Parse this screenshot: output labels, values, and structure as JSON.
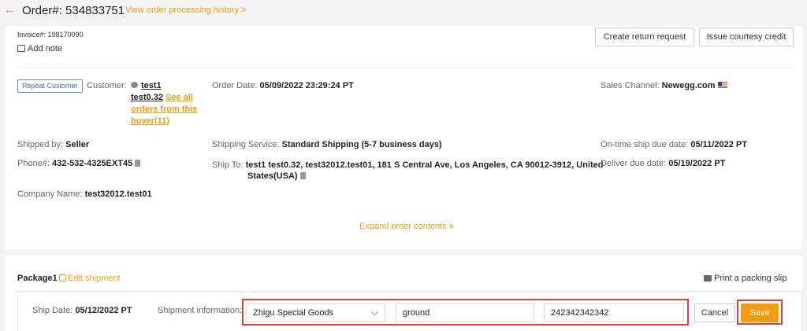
{
  "header": {
    "back_icon": "arrow-left-icon",
    "order_title": "Order#: 534833751",
    "history_link": "View order processing history >"
  },
  "invoice": "Invoice#: 198170090",
  "add_note": "Add note",
  "actions": {
    "create_return": "Create return request",
    "issue_credit": "Issue courtesy credit"
  },
  "customer": {
    "badge": "Repeat Customer",
    "label": "Customer:",
    "name_line1": "test1",
    "name_line2": "test0.32",
    "see_all_1": "See all",
    "see_all_2": "orders from this",
    "see_all_3": "buyer(11)"
  },
  "order_date": {
    "label": "Order Date:",
    "value": "05/09/2022 23:29:24 PT"
  },
  "sales_channel": {
    "label": "Sales Channel:",
    "value": "Newegg.com"
  },
  "shipped_by": {
    "label": "Shipped by:",
    "value": "Seller"
  },
  "shipping_service": {
    "label": "Shipping Service:",
    "value": "Standard Shipping (5-7 business days)"
  },
  "ontime_due": {
    "label": "On-time ship due date:",
    "value": "05/11/2022 PT"
  },
  "phone": {
    "label": "Phone#:",
    "value": "432-532-4325EXT45"
  },
  "ship_to": {
    "label": "Ship To:",
    "line1": "test1 test0.32, test32012.test01, 181 S Central Ave, Los Angeles, CA 90012-3912, United",
    "line2": "States(USA)"
  },
  "deliver_due": {
    "label": "Deliver due date:",
    "value": "05/19/2022 PT"
  },
  "company": {
    "label": "Company Name:",
    "value": "test32012.test01"
  },
  "expand": "Expand order contents",
  "package": {
    "title": "Package1",
    "edit": "Edit shipment",
    "print": "Print a packing slip",
    "ship_date_label": "Ship Date:",
    "ship_date_value": "05/12/2022 PT",
    "shipment_info_label": "Shipment information:",
    "carrier": "Zhigu Special Goods",
    "service": "ground",
    "tracking": "242342342342",
    "cancel": "Cancel",
    "save": "Save"
  },
  "colors": {
    "accent": "#f39c12",
    "highlight": "#e0403a",
    "badge": "#3a6fc1"
  }
}
